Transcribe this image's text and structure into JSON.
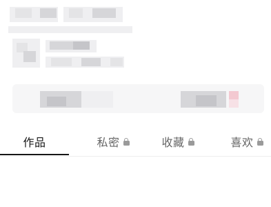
{
  "tabs": [
    {
      "label": "作品",
      "locked": false,
      "active": true
    },
    {
      "label": "私密",
      "locked": true,
      "active": false
    },
    {
      "label": "收藏",
      "locked": true,
      "active": false
    },
    {
      "label": "喜欢",
      "locked": true,
      "active": false
    }
  ],
  "icons": {
    "lock": "lock-icon"
  },
  "colors": {
    "active_text": "#161616",
    "inactive_text": "#666666",
    "indicator": "#161616",
    "lock": "#9a9a9a"
  }
}
